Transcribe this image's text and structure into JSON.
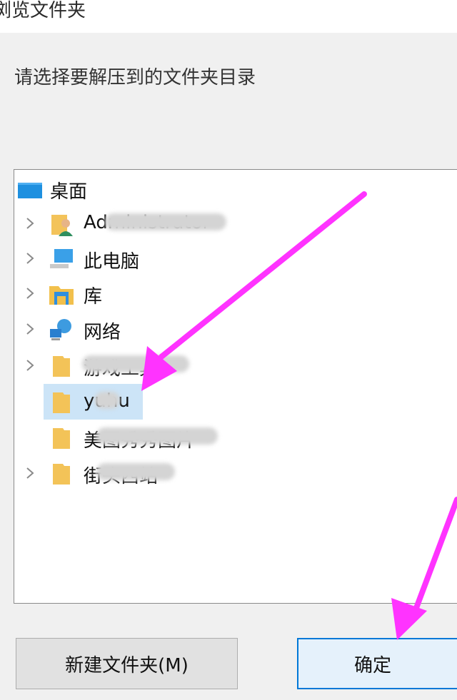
{
  "window": {
    "title": "浏览文件夹"
  },
  "prompt": "请选择要解压到的文件夹目录",
  "tree": {
    "root": {
      "label": "桌面",
      "icon": "desktop-icon"
    },
    "items": [
      {
        "label": "Administrator",
        "icon": "user-folder-icon",
        "expandable": true,
        "label_blurred": true
      },
      {
        "label": "此电脑",
        "icon": "computer-icon",
        "expandable": true
      },
      {
        "label": "库",
        "icon": "library-icon",
        "expandable": true
      },
      {
        "label": "网络",
        "icon": "network-icon",
        "expandable": true
      },
      {
        "label": "游戏工具",
        "icon": "folder-icon",
        "expandable": true,
        "label_blurred": true
      },
      {
        "label": "yuhu",
        "icon": "folder-icon",
        "expandable": false,
        "selected": true,
        "label_blurred": true
      },
      {
        "label": "美图秀秀图片",
        "icon": "folder-icon",
        "expandable": false,
        "label_blurred": true
      },
      {
        "label": "街头西站",
        "icon": "folder-icon",
        "expandable": true,
        "label_blurred": true
      }
    ]
  },
  "buttons": {
    "new_folder": "新建文件夹(M)",
    "ok": "确定"
  },
  "annotations": {
    "arrow_color": "#ff33ff"
  }
}
